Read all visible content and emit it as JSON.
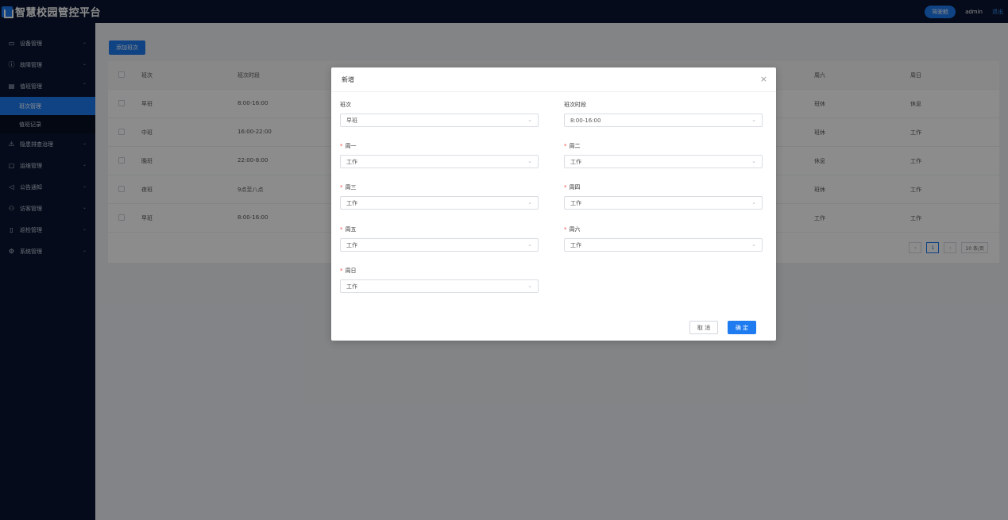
{
  "header": {
    "title": "智慧校园管控平台",
    "pill": "驾驶舱",
    "user": "admin",
    "logout": "退出"
  },
  "sidebar": {
    "items": [
      {
        "label": "设备管理",
        "icon": "monitor-icon"
      },
      {
        "label": "故障管理",
        "icon": "alert-circle-icon"
      },
      {
        "label": "值班管理",
        "icon": "calendar-icon"
      },
      {
        "label": "班次管理",
        "sub": true,
        "active": true
      },
      {
        "label": "值班记录",
        "sub": true
      },
      {
        "label": "隐患排查治理",
        "icon": "warning-triangle-icon"
      },
      {
        "label": "运维管理",
        "icon": "briefcase-icon"
      },
      {
        "label": "公告通知",
        "icon": "megaphone-icon"
      },
      {
        "label": "访客管理",
        "icon": "people-icon"
      },
      {
        "label": "巡检管理",
        "icon": "clipboard-icon"
      },
      {
        "label": "系统管理",
        "icon": "gear-icon"
      }
    ]
  },
  "main": {
    "add_button": "添加班次",
    "table": {
      "columns": [
        "班次",
        "班次时段",
        "周六",
        "周日"
      ],
      "rows": [
        {
          "shift": "早班",
          "time": "8:00-16:00",
          "sat": "班休",
          "sun": "休息"
        },
        {
          "shift": "中班",
          "time": "16:00-22:00",
          "sat": "班休",
          "sun": "工作"
        },
        {
          "shift": "晚班",
          "time": "22:00-8:00",
          "sat": "休息",
          "sun": "工作"
        },
        {
          "shift": "夜班",
          "time": "9点至八点",
          "sat": "班休",
          "sun": "工作"
        },
        {
          "shift": "早班",
          "time": "8:00-16:00",
          "sat": "工作",
          "sun": "工作"
        }
      ]
    },
    "pager": {
      "prev": "‹",
      "current": "1",
      "next": "›",
      "size": "10 条/页"
    }
  },
  "modal": {
    "title": "新增",
    "close": "×",
    "fields": [
      {
        "label": "班次",
        "value": "早班",
        "required": false
      },
      {
        "label": "班次时段",
        "value": "8:00-16:00",
        "required": false
      },
      {
        "label": "周一",
        "value": "工作",
        "required": true
      },
      {
        "label": "周二",
        "value": "工作",
        "required": true
      },
      {
        "label": "周三",
        "value": "工作",
        "required": true
      },
      {
        "label": "周四",
        "value": "工作",
        "required": true
      },
      {
        "label": "周五",
        "value": "工作",
        "required": true
      },
      {
        "label": "周六",
        "value": "工作",
        "required": true
      },
      {
        "label": "周日",
        "value": "工作",
        "required": true
      }
    ],
    "cancel": "取 消",
    "ok": "确 定"
  },
  "colors": {
    "header_bg": "#0a1430",
    "accent": "#1e7bf0",
    "required": "#f24c4c"
  }
}
